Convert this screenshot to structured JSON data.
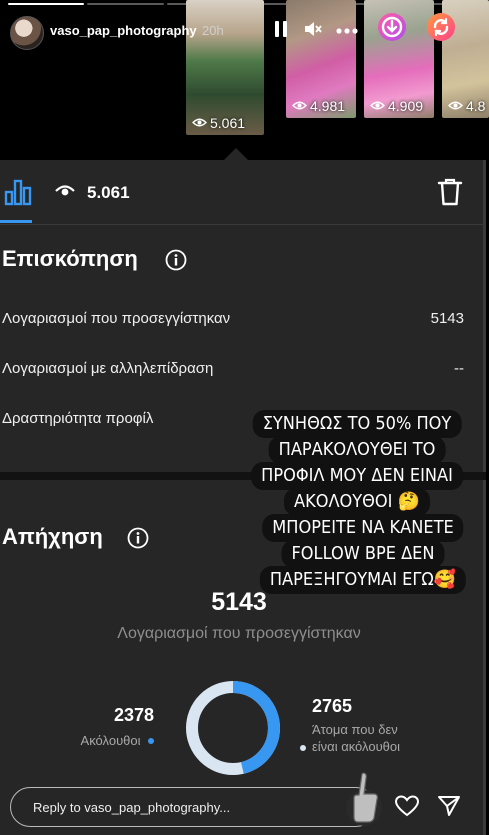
{
  "story": {
    "progress_segments": 6,
    "progress_done": 1
  },
  "header": {
    "username": "vaso_pap_photography",
    "time": "20h",
    "icons": [
      "pause-icon",
      "mute-icon",
      "more-icon",
      "download-icon",
      "reshare-icon"
    ]
  },
  "thumbnails": [
    {
      "views": "5.061"
    },
    {
      "views": "4.981"
    },
    {
      "views": "4.909"
    },
    {
      "views": "4.8"
    }
  ],
  "insights_tab": {
    "views": "5.061"
  },
  "overview": {
    "title": "Επισκόπηση",
    "rows": [
      {
        "label": "Λογαριασμοί που προσεγγίστηκαν",
        "value": "5143"
      },
      {
        "label": "Λογαριασμοί με αλληλεπίδραση",
        "value": "--"
      },
      {
        "label": "Δραστηριότητα προφίλ",
        "value": ""
      }
    ]
  },
  "reach": {
    "title": "Απήχηση",
    "total": "5143",
    "total_label": "Λογαριασμοί που προσεγγίστηκαν",
    "followers_value": "2378",
    "followers_label": "Ακόλουθοι",
    "non_followers_value": "2765",
    "non_followers_line1": "Άτομα που δεν",
    "non_followers_line2": "είναι ακόλουθοι",
    "followers_color": "#3897f0",
    "non_followers_color": "#d9e6f2"
  },
  "sticker": {
    "lines": [
      "ΣΥΝΗΘΩΣ ΤΟ 50% ΠΟΥ",
      "ΠΑΡΑΚΟΛΟΥΘΕΙ ΤΟ",
      "ΠΡΟΦΙΛ ΜΟΥ ΔΕΝ ΕΙΝΑΙ",
      "ΑΚΟΛΟΥΘΟΙ 🤔",
      "ΜΠΟΡΕΙΤΕ ΝΑ ΚΑΝΕΤΕ",
      "FOLLOW ΒΡΕ ΔΕΝ",
      "ΠΑΡΕΞΗΓΟΥΜΑΙ ΕΓΩ🥰"
    ]
  },
  "reply": {
    "placeholder": "Reply to vaso_pap_photography..."
  },
  "colors": {
    "accent": "#3897f0",
    "panel": "#262626"
  }
}
